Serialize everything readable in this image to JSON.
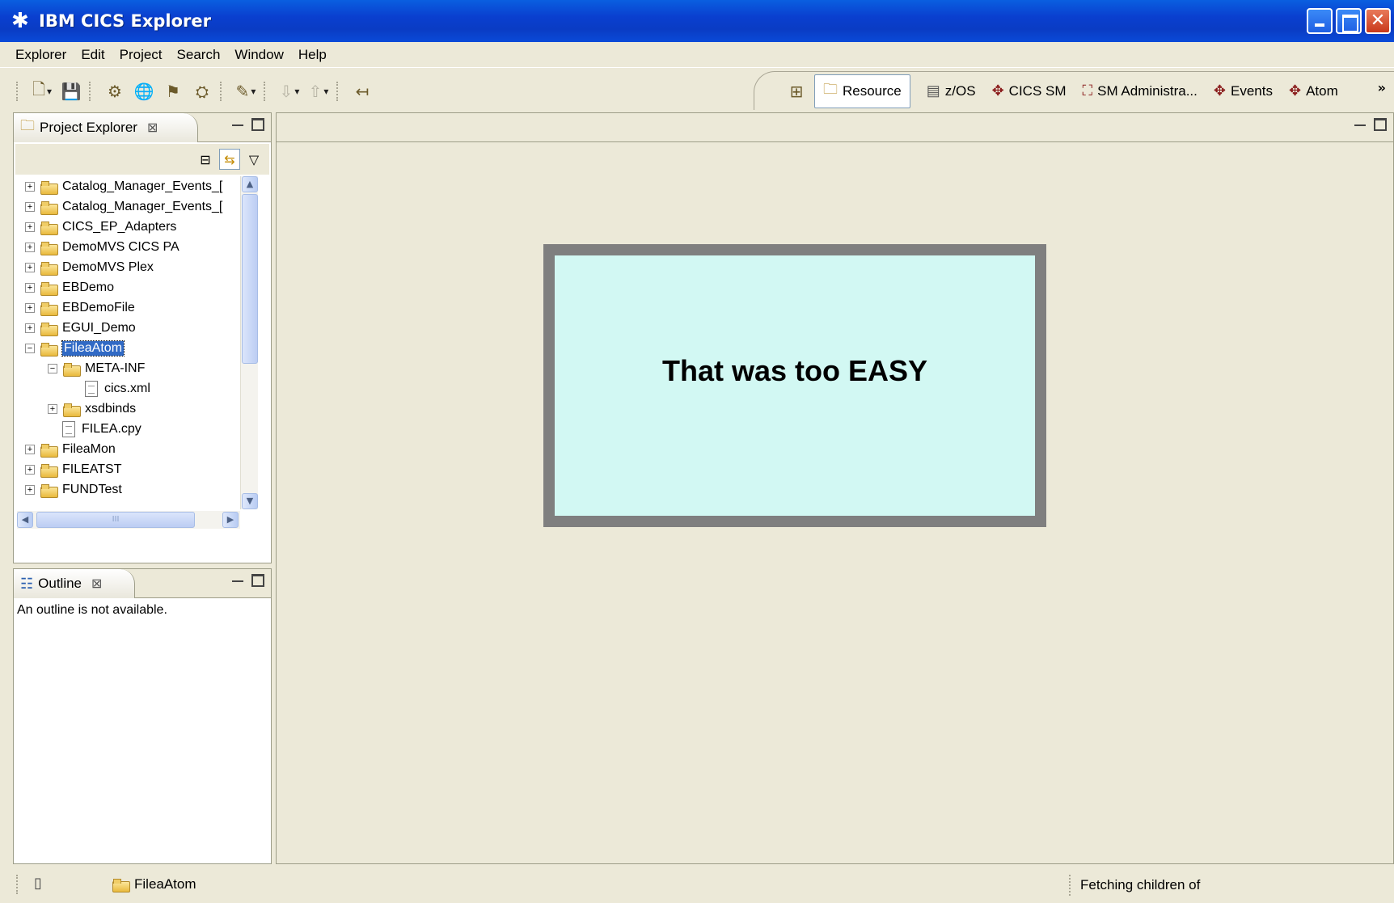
{
  "window": {
    "title": "IBM CICS Explorer"
  },
  "menu": [
    "Explorer",
    "Edit",
    "Project",
    "Search",
    "Window",
    "Help"
  ],
  "perspectives": [
    {
      "label": "Resource",
      "icon": "resource-perspective-icon",
      "active": true
    },
    {
      "label": "z/OS",
      "icon": "zos-perspective-icon"
    },
    {
      "label": "CICS SM",
      "icon": "cics-sm-perspective-icon"
    },
    {
      "label": "SM Administra...",
      "icon": "sm-admin-perspective-icon"
    },
    {
      "label": "Events",
      "icon": "events-perspective-icon"
    },
    {
      "label": "Atom",
      "icon": "atom-perspective-icon"
    }
  ],
  "project_explorer": {
    "title": "Project Explorer",
    "items": [
      {
        "label": "Catalog_Manager_Events_[",
        "level": 0,
        "state": "+"
      },
      {
        "label": "Catalog_Manager_Events_[",
        "level": 0,
        "state": "+"
      },
      {
        "label": "CICS_EP_Adapters",
        "level": 0,
        "state": "+"
      },
      {
        "label": "DemoMVS CICS PA",
        "level": 0,
        "state": "+"
      },
      {
        "label": "DemoMVS Plex",
        "level": 0,
        "state": "+"
      },
      {
        "label": "EBDemo",
        "level": 0,
        "state": "+"
      },
      {
        "label": "EBDemoFile",
        "level": 0,
        "state": "+"
      },
      {
        "label": "EGUI_Demo",
        "level": 0,
        "state": "+"
      },
      {
        "label": "FileaAtom",
        "level": 0,
        "state": "-",
        "selected": true
      },
      {
        "label": "META-INF",
        "level": 1,
        "state": "-"
      },
      {
        "label": "cics.xml",
        "level": 2,
        "file": true
      },
      {
        "label": "xsdbinds",
        "level": 1,
        "state": "+"
      },
      {
        "label": "FILEA.cpy",
        "level": 1,
        "file": true
      },
      {
        "label": "FileaMon",
        "level": 0,
        "state": "+"
      },
      {
        "label": "FILEATST",
        "level": 0,
        "state": "+"
      },
      {
        "label": "FUNDTest",
        "level": 0,
        "state": "+"
      }
    ]
  },
  "outline": {
    "title": "Outline",
    "message": "An outline is not available."
  },
  "editor": {
    "callout": "That was too EASY"
  },
  "status": {
    "selection": "FileaAtom",
    "progress": "Fetching children of"
  }
}
